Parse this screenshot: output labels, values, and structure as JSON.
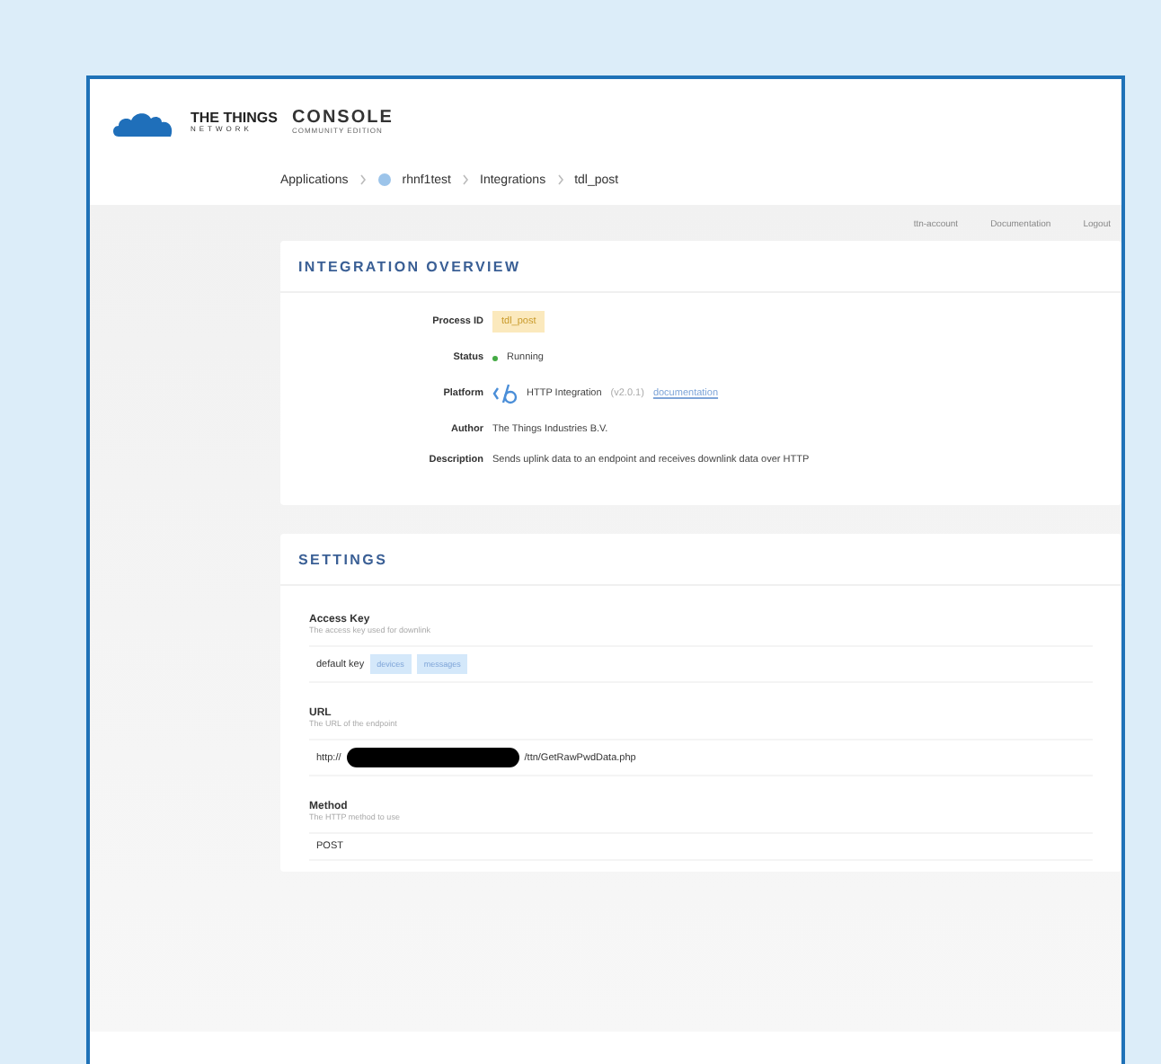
{
  "header": {
    "brand_top": "THE THINGS",
    "brand_bottom": "NETWORK",
    "title": "CONSOLE",
    "subtitle": "COMMUNITY EDITION"
  },
  "breadcrumbs": [
    {
      "label": "Applications",
      "icon": false
    },
    {
      "label": "rhnf1test",
      "icon": true
    },
    {
      "label": "Integrations",
      "icon": false
    },
    {
      "label": "tdl_post",
      "icon": false
    }
  ],
  "top_links": [
    "ttn-account",
    "Documentation",
    "Logout"
  ],
  "overview": {
    "title": "INTEGRATION OVERVIEW",
    "rows": [
      {
        "kind": "badge",
        "label": "Process ID",
        "value": "tdl_post"
      },
      {
        "kind": "status",
        "label": "Status",
        "value": "Running"
      },
      {
        "kind": "platform",
        "label": "Platform",
        "value": "HTTP Integration",
        "version": "(v2.0.1)",
        "link": "documentation"
      },
      {
        "kind": "text",
        "label": "Author",
        "value": "The Things Industries B.V."
      },
      {
        "kind": "text",
        "label": "Description",
        "value": "Sends uplink data to an endpoint and receives downlink data over HTTP"
      }
    ]
  },
  "settings": {
    "title": "SETTINGS",
    "fields": [
      {
        "kind": "key",
        "label": "Access Key",
        "hint": "The access key used for downlink",
        "value": "default key",
        "tags": [
          "devices",
          "messages"
        ]
      },
      {
        "kind": "url",
        "label": "URL",
        "hint": "The URL of the endpoint",
        "value_start": "http://",
        "value_end": "/ttn/GetRawPwdData.php"
      },
      {
        "kind": "text",
        "label": "Method",
        "hint": "The HTTP method to use",
        "value": "POST"
      }
    ]
  }
}
